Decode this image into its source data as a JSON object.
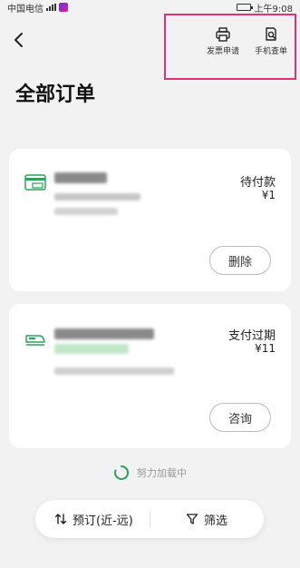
{
  "status_bar": {
    "carrier": "中国电信",
    "time": "上午9:08"
  },
  "header": {
    "invoice_label": "发票申请",
    "phone_query_label": "手机查单"
  },
  "page": {
    "title": "全部订单"
  },
  "orders": [
    {
      "status": "待付款",
      "price": "¥1",
      "action": "删除"
    },
    {
      "status": "支付过期",
      "price": "¥11",
      "action": "咨询"
    }
  ],
  "loading": {
    "text": "努力加载中"
  },
  "bottom_bar": {
    "sort_label": "预订(近-远)",
    "filter_label": "筛选"
  },
  "colors": {
    "accent": "#2aa35a",
    "highlight_box": "#e0327a",
    "card_bg": "#ffffff",
    "page_bg": "#f2f2f2"
  }
}
